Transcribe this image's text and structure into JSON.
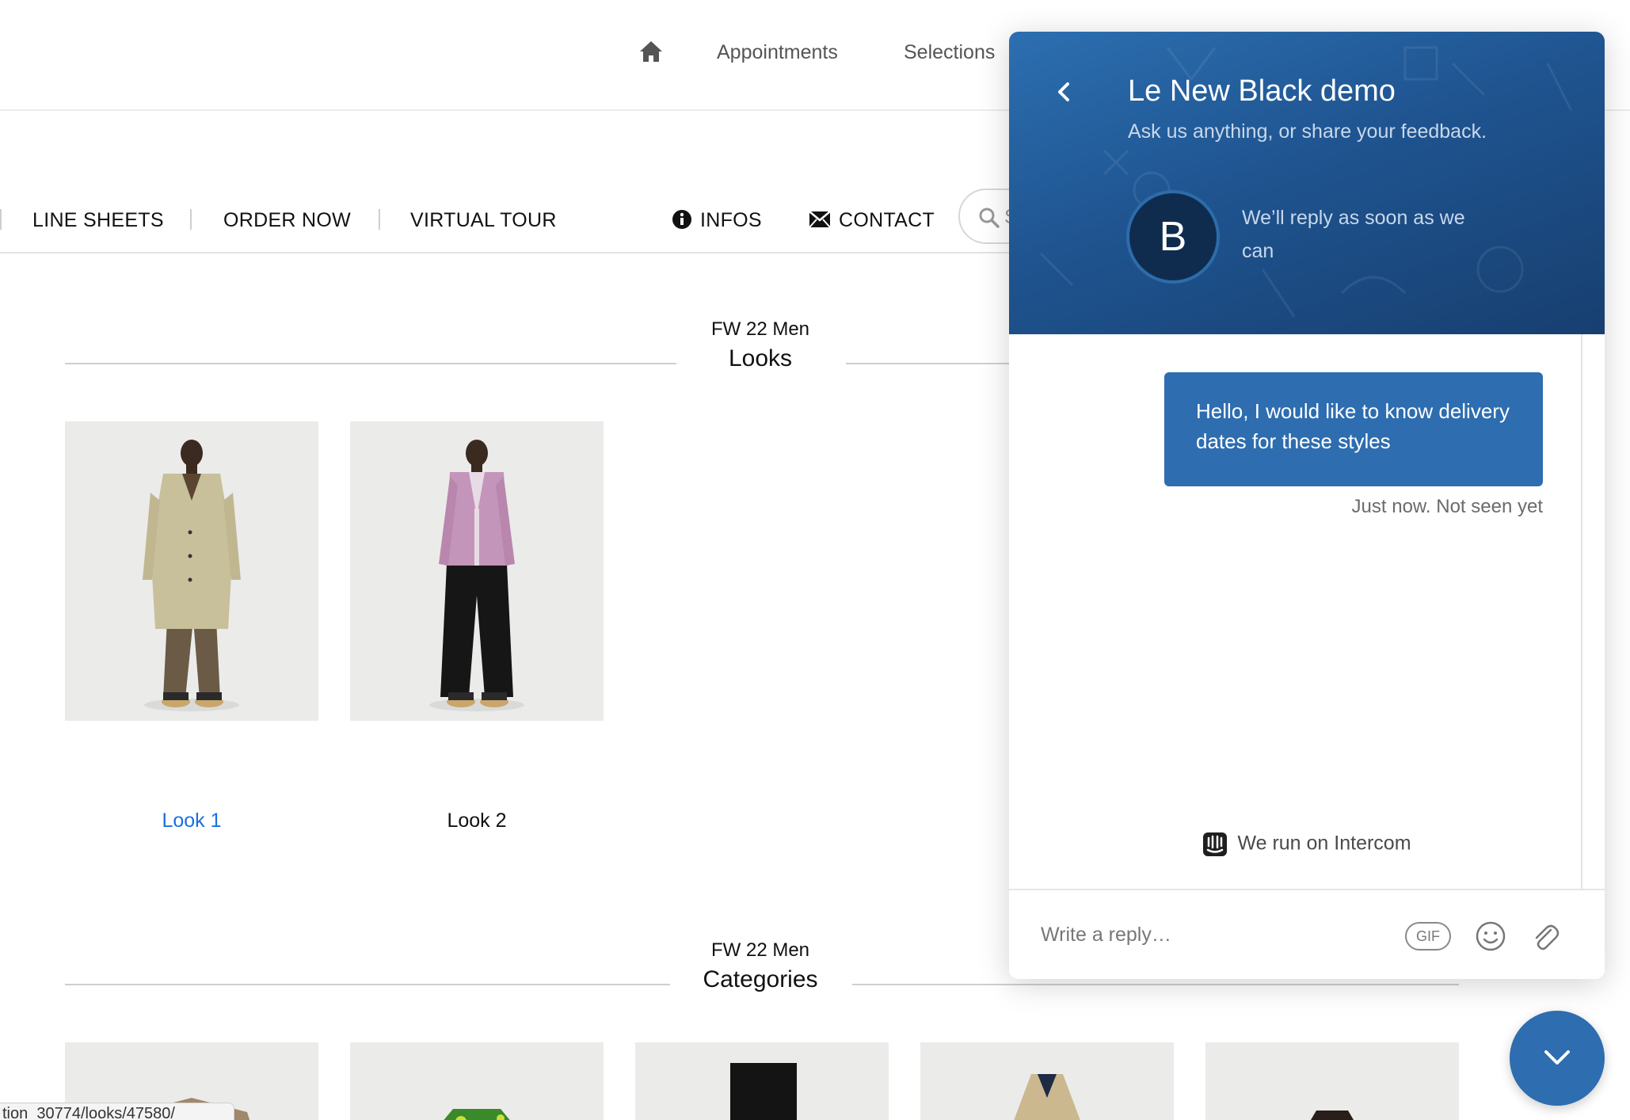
{
  "top_nav": {
    "links": [
      "Appointments",
      "Selections"
    ]
  },
  "sub_nav": {
    "items": [
      "LINE SHEETS",
      "ORDER NOW",
      "VIRTUAL TOUR"
    ],
    "infos": "INFOS",
    "contact": "CONTACT",
    "search_placeholder": "S"
  },
  "looks": {
    "kicker": "FW 22 Men",
    "title": "Looks",
    "items": [
      {
        "label": "Look 1",
        "color": "#1a6fe0"
      },
      {
        "label": "Look 2",
        "color": "#111111"
      }
    ]
  },
  "categories": {
    "kicker": "FW 22 Men",
    "title": "Categories"
  },
  "status_url": "tion_30774/looks/47580/",
  "chat": {
    "title": "Le New Black demo",
    "subtitle": "Ask us anything, or share your feedback.",
    "avatar_letter": "B",
    "reply_note": "We’ll reply as soon as we can",
    "message": "Hello, I would like to know delivery dates for these styles",
    "message_status": "Just now. Not seen yet",
    "powered_by": "We run on Intercom",
    "composer_placeholder": "Write a reply…",
    "gif_label": "GIF"
  },
  "colors": {
    "brand_blue": "#2d6db0",
    "link_blue": "#1a6fe0"
  }
}
